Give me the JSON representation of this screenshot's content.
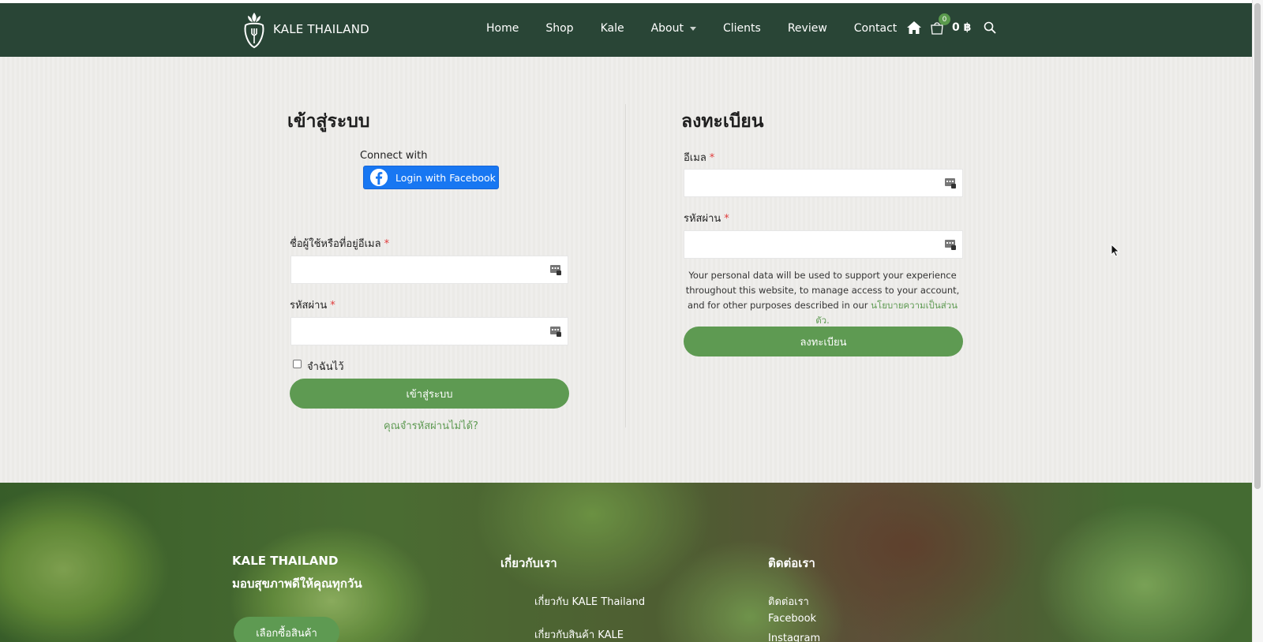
{
  "brand": {
    "name": "KALE THAILAND"
  },
  "nav": {
    "items": [
      {
        "label": "Home"
      },
      {
        "label": "Shop"
      },
      {
        "label": "Kale"
      },
      {
        "label": "About"
      },
      {
        "label": "Clients"
      },
      {
        "label": "Review"
      },
      {
        "label": "Contact"
      }
    ],
    "cart_count": "0",
    "cart_total": "0 ฿",
    "icons": [
      "home-icon",
      "cart-icon",
      "search-icon"
    ]
  },
  "login": {
    "title": "เข้าสู่ระบบ",
    "connect_with": "Connect with",
    "facebook_button": "Login with Facebook",
    "username_label": "ชื่อผู้ใช้หรือที่อยู่อีเมล",
    "username_value": "",
    "password_label": "รหัสผ่าน",
    "password_value": "",
    "required_mark": "*",
    "remember_label": "จำฉันไว้",
    "submit_label": "เข้าสู่ระบบ",
    "forgot_label": "คุณจำรหัสผ่านไม่ได้?"
  },
  "register": {
    "title": "ลงทะเบียน",
    "email_label": "อีเมล",
    "email_value": "",
    "password_label": "รหัสผ่าน",
    "password_value": "",
    "required_mark": "*",
    "privacy_text": "Your personal data will be used to support your experience throughout this website, to manage access to your account, and for other purposes described in our",
    "privacy_link": "นโยบายความเป็นส่วนตัว.",
    "submit_label": "ลงทะเบียน"
  },
  "footer": {
    "col1_title": "KALE THAILAND",
    "col1_subtitle": "มอบสุขภาพดีให้คุณทุกวัน",
    "col1_button": "เลือกซื้อสินค้า",
    "col2_title": "เกี่ยวกับเรา",
    "col2_links": [
      "เกี่ยวกับ KALE Thailand",
      "เกี่ยวกับสินค้า KALE"
    ],
    "col3_title": "ติดต่อเรา",
    "col3_links": [
      "ติดต่อเรา",
      "Facebook",
      "Instagram"
    ]
  },
  "colors": {
    "header_bg": "#294536",
    "accent_green": "#5e9a52",
    "facebook_blue": "#1877f2"
  }
}
